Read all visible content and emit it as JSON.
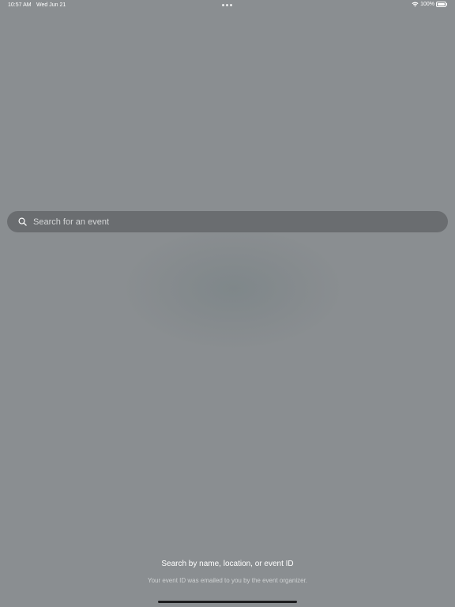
{
  "status_bar": {
    "time": "10:57 AM",
    "date": "Wed Jun 21",
    "battery": "100%",
    "wifi_icon": "wifi-icon",
    "battery_icon": "battery-icon",
    "multitask_icon": "ellipsis-icon"
  },
  "search": {
    "placeholder": "Search for an event",
    "value": "",
    "icon": "search-icon"
  },
  "hint": {
    "title": "Search by name, location, or event ID",
    "subtitle": "Your event ID was emailed to you by the event organizer."
  },
  "colors": {
    "background": "#8a8e91",
    "search_bar": "#6a6d70",
    "text": "#ffffff"
  }
}
